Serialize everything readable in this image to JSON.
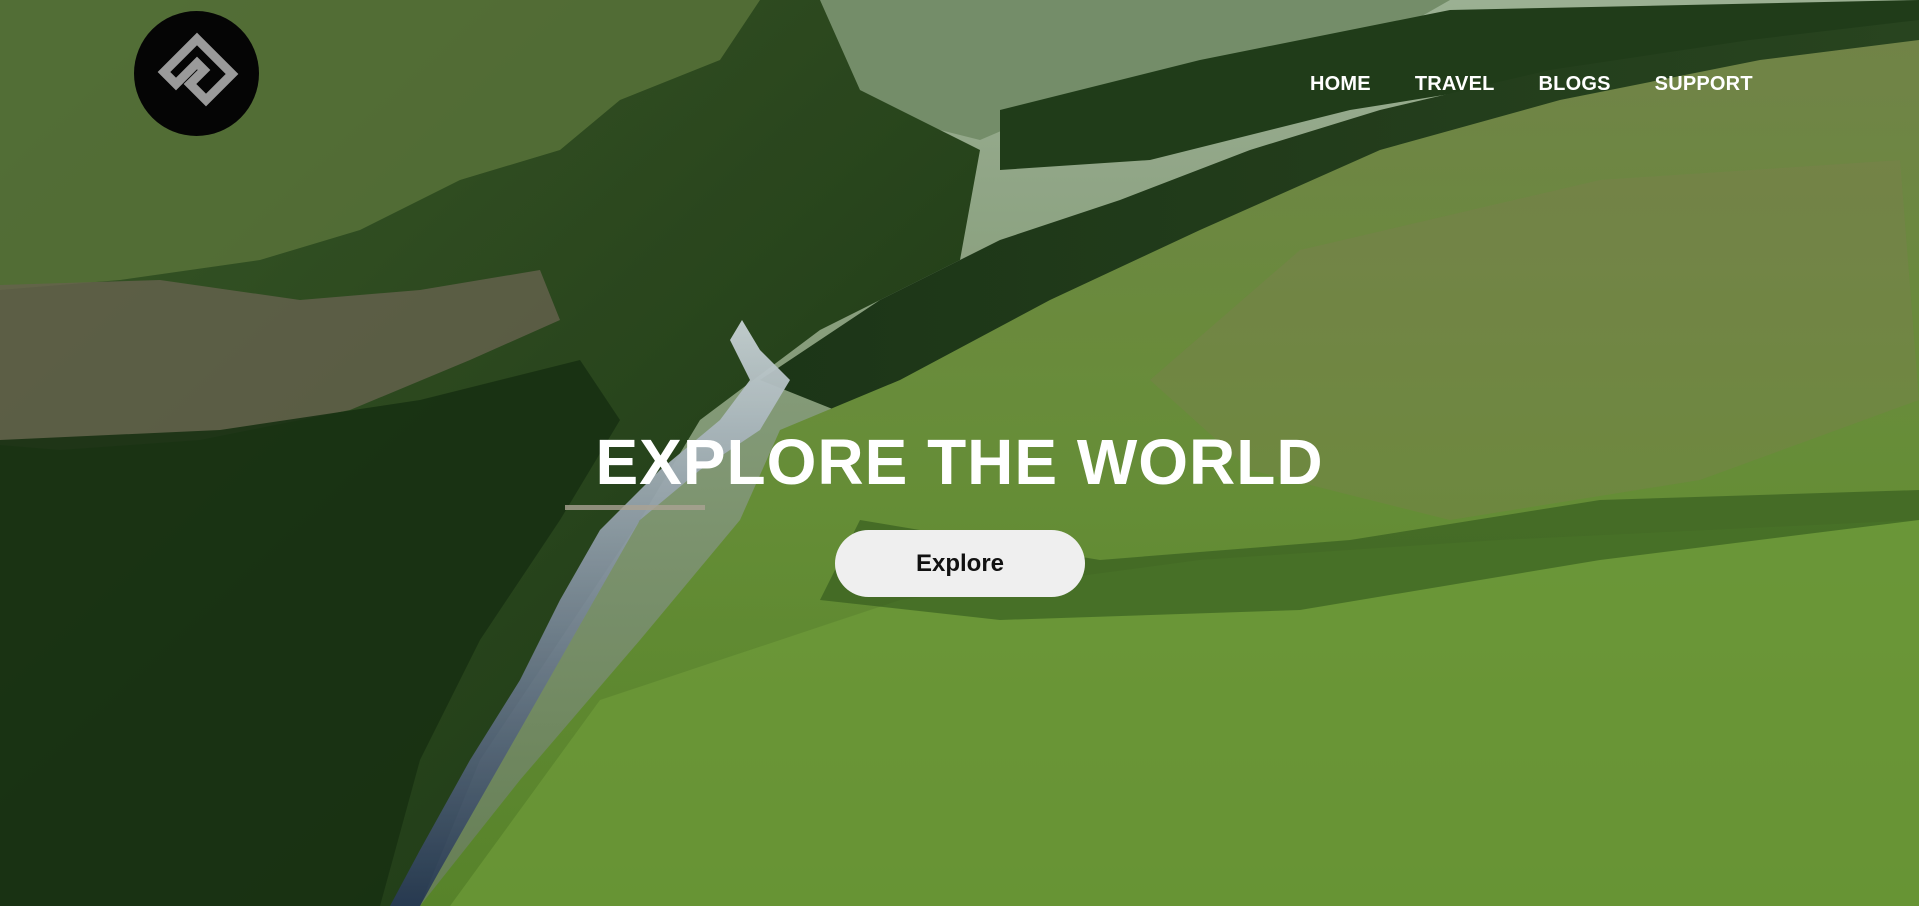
{
  "logo": {
    "icon": "diamond-arrow-logo-icon"
  },
  "nav": {
    "items": [
      {
        "label": "HOME"
      },
      {
        "label": "TRAVEL"
      },
      {
        "label": "BLOGS"
      },
      {
        "label": "SUPPORT"
      }
    ]
  },
  "hero": {
    "title": "EXPLORE THE WORLD",
    "cta_label": "Explore",
    "background": "aerial-canyon-river-photo"
  },
  "colors": {
    "nav_text": "#ffffff",
    "cta_bg": "#efefef",
    "cta_text": "#111111",
    "logo_bg": "#050505"
  }
}
